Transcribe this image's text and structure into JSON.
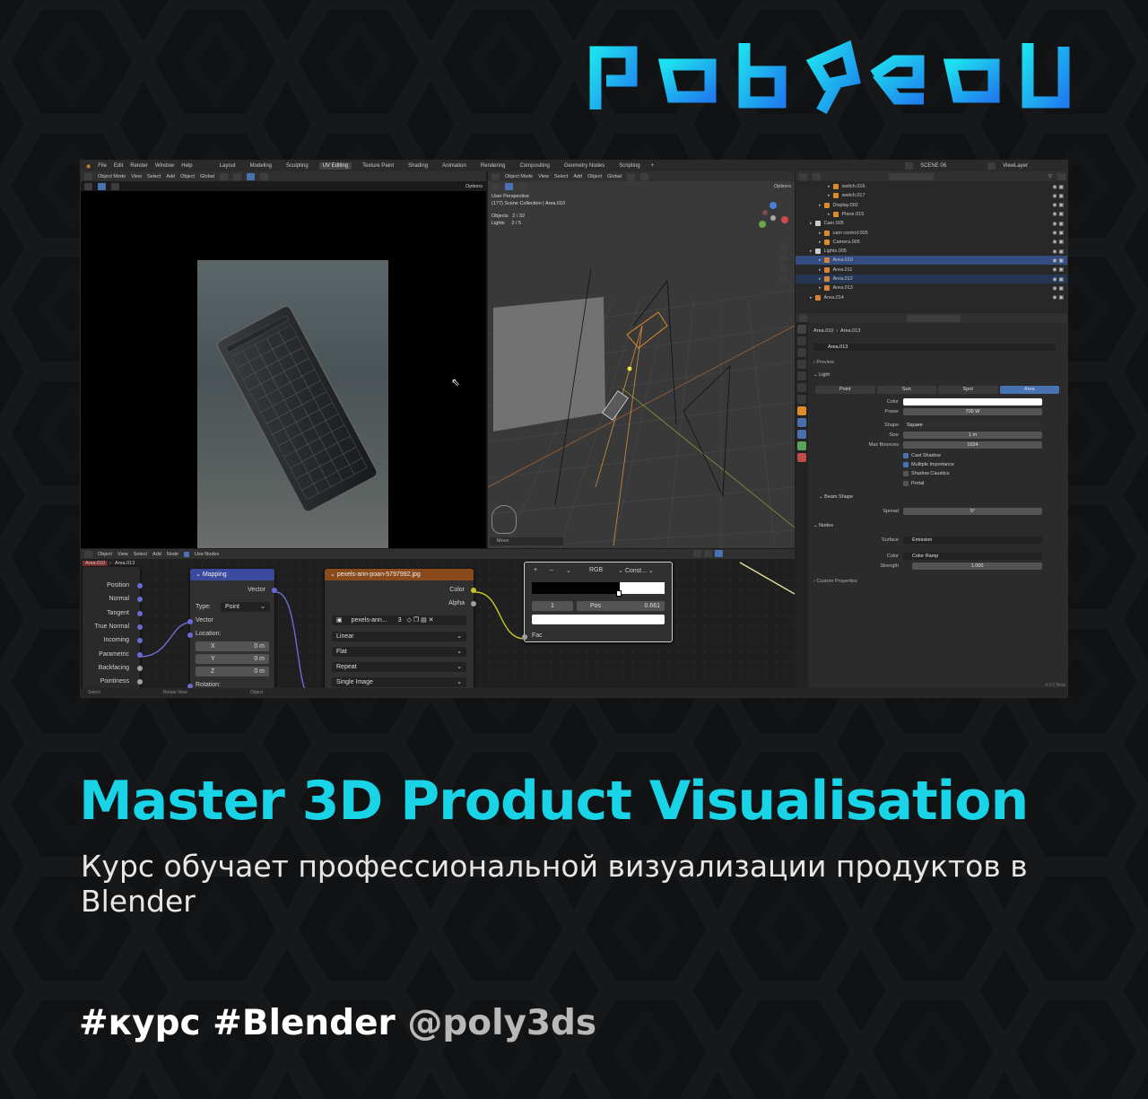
{
  "brand": {
    "logo_text": "poly3ds",
    "accent_color": "#19d3e6",
    "accent_color_2": "#1f8ef0"
  },
  "blender": {
    "menu": [
      "File",
      "Edit",
      "Render",
      "Window",
      "Help"
    ],
    "workspaces": [
      "Layout",
      "Modeling",
      "Sculpting",
      "UV Editing",
      "Texture Paint",
      "Shading",
      "Animation",
      "Rendering",
      "Compositing",
      "Geometry Nodes",
      "Scripting"
    ],
    "active_workspace": "UV Editing",
    "scene_name": "SCENE 06",
    "view_layer": "ViewLayer",
    "viewport_header": {
      "mode": "Object Mode",
      "items": [
        "View",
        "Select",
        "Add",
        "Object"
      ],
      "orientation": "Global",
      "options": "Options"
    },
    "viewport_info": {
      "line1": "User Perspective",
      "line2": "(177) Scene Collection | Area.010",
      "objects_label": "Objects",
      "objects_value": "2 / 32",
      "lights_label": "Lights",
      "lights_value": "2 / 5",
      "move_label": "Move"
    },
    "outliner": [
      {
        "name": "switch.016",
        "indent": 2,
        "sel": ""
      },
      {
        "name": "switch.017",
        "indent": 2,
        "sel": ""
      },
      {
        "name": "Display.002",
        "indent": 1,
        "sel": ""
      },
      {
        "name": "Plane.015",
        "indent": 2,
        "sel": ""
      },
      {
        "name": "Cam.005",
        "indent": 0,
        "sel": ""
      },
      {
        "name": "cam control.005",
        "indent": 1,
        "sel": ""
      },
      {
        "name": "Camera.005",
        "indent": 1,
        "sel": ""
      },
      {
        "name": "Lights.005",
        "indent": 0,
        "sel": ""
      },
      {
        "name": "Area.010",
        "indent": 1,
        "sel": "sel"
      },
      {
        "name": "Area.011",
        "indent": 1,
        "sel": ""
      },
      {
        "name": "Area.012",
        "indent": 1,
        "sel": "sel2"
      },
      {
        "name": "Area.013",
        "indent": 1,
        "sel": ""
      },
      {
        "name": "Area.014",
        "indent": 0,
        "sel": ""
      }
    ],
    "properties": {
      "breadcrumb_a": "Area.010",
      "breadcrumb_b": "Area.013",
      "datablock": "Area.013",
      "preview": "Preview",
      "light": "Light",
      "light_types": [
        "Point",
        "Sun",
        "Spot",
        "Area"
      ],
      "active_light_type": "Area",
      "color_label": "Color",
      "power_label": "Power",
      "power_value": "700 W",
      "shape_label": "Shape",
      "shape_value": "Square",
      "size_label": "Size",
      "size_value": "1 m",
      "bounces_label": "Max Bounces",
      "bounces_value": "1024",
      "cast_shadow": "Cast Shadow",
      "multiple_importance": "Multiple Importance",
      "shadow_caustics": "Shadow Caustics",
      "portal": "Portal",
      "beam_shape": "Beam Shape",
      "spread_label": "Spread",
      "spread_value": "5°",
      "nodes": "Nodes",
      "surface_label": "Surface",
      "surface_value": "Emission",
      "ncolor_label": "Color",
      "ncolor_value": "Color Ramp",
      "strength_label": "Strength",
      "strength_value": "1.000",
      "custom_props": "Custom Properties",
      "version": "4.0.0 Beta"
    },
    "node_editor": {
      "header": {
        "object": "Object",
        "items": [
          "View",
          "Select",
          "Add",
          "Node"
        ],
        "use_nodes": "Use Nodes",
        "breadcrumb_a": "Area.010",
        "breadcrumb_b": "Area.013"
      },
      "texcoord_outputs": [
        "Position",
        "Normal",
        "Tangent",
        "True Normal",
        "Incoming",
        "Parametric",
        "Backfacing",
        "Pointiness"
      ],
      "mapping": {
        "title": "Mapping",
        "vector_out": "Vector",
        "type_label": "Type:",
        "type_value": "Point",
        "vector_in": "Vector",
        "location": "Location:",
        "x_label": "X",
        "x_value": "0 m",
        "y_label": "Y",
        "y_value": "0 m",
        "z_label": "Z",
        "z_value": "0 m",
        "rotation": "Rotation:"
      },
      "image": {
        "title": "pexels-ann-poan-5797992.jpg",
        "color": "Color",
        "alpha": "Alpha",
        "file_short": "pexels-ann...",
        "users": "3",
        "interpolation": "Linear",
        "projection": "Flat",
        "extension": "Repeat",
        "source": "Single Image"
      },
      "ramp": {
        "plus": "+",
        "minus": "–",
        "chev": "⌄",
        "mode": "RGB",
        "interp": "Const...",
        "index": "1",
        "pos_label": "Pos",
        "pos_value": "0.661",
        "fac": "Fac"
      }
    },
    "status_bar": [
      "Select",
      "Rotate View",
      "Object"
    ]
  },
  "title": "Master 3D Product Visualisation",
  "subtitle": "Курс обучает профессиональной визуализации продуктов в Blender",
  "hashtags": "#курс #Blender",
  "handle": "@poly3ds"
}
